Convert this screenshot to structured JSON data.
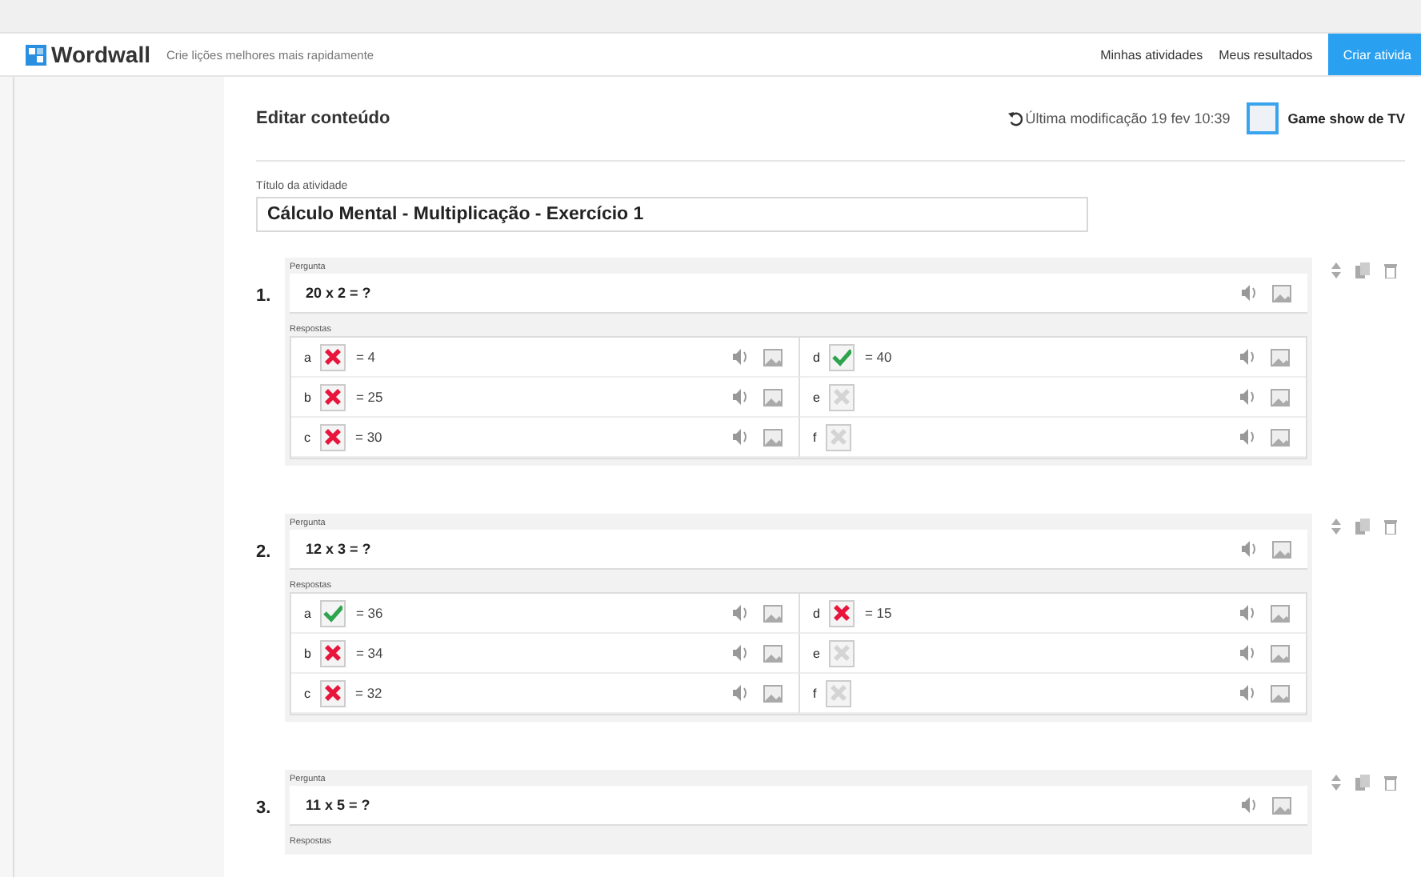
{
  "header": {
    "logo": "Wordwall",
    "tagline": "Crie lições melhores mais rapidamente",
    "nav": [
      "Minhas atividades",
      "Meus resultados"
    ],
    "create_button": "Criar ativida"
  },
  "editor": {
    "heading": "Editar conteúdo",
    "last_modified": "Última modificação 19 fev 10:39",
    "template": "Game show de TV",
    "title_label": "Título da atividade",
    "title_value": "Cálculo Mental - Multiplicação - Exercício 1"
  },
  "questions": [
    {
      "number": "1.",
      "question_label": "Pergunta",
      "question": "20 x 2 = ?",
      "answers_label": "Respostas",
      "answers": [
        {
          "letter": "a",
          "text": "= 4",
          "correct": false,
          "disabled": false
        },
        {
          "letter": "b",
          "text": "= 25",
          "correct": false,
          "disabled": false
        },
        {
          "letter": "c",
          "text": "= 30",
          "correct": false,
          "disabled": false
        },
        {
          "letter": "d",
          "text": "= 40",
          "correct": true,
          "disabled": false
        },
        {
          "letter": "e",
          "correct": false,
          "disabled": true
        },
        {
          "letter": "f",
          "correct": false,
          "disabled": true
        }
      ]
    },
    {
      "number": "2.",
      "question_label": "Pergunta",
      "question": "12 x 3 = ?",
      "answers_label": "Respostas",
      "answers": [
        {
          "letter": "a",
          "text": "= 36",
          "correct": true,
          "disabled": false
        },
        {
          "letter": "b",
          "text": "= 34",
          "correct": false,
          "disabled": false
        },
        {
          "letter": "c",
          "text": "= 32",
          "correct": false,
          "disabled": false
        },
        {
          "letter": "d",
          "text": "= 15",
          "correct": false,
          "disabled": false
        },
        {
          "letter": "e",
          "correct": false,
          "disabled": true
        },
        {
          "letter": "f",
          "correct": false,
          "disabled": true
        }
      ]
    },
    {
      "number": "3.",
      "question_label": "Pergunta",
      "question": "11 x 5 = ?",
      "answers_label": "Respostas"
    }
  ]
}
